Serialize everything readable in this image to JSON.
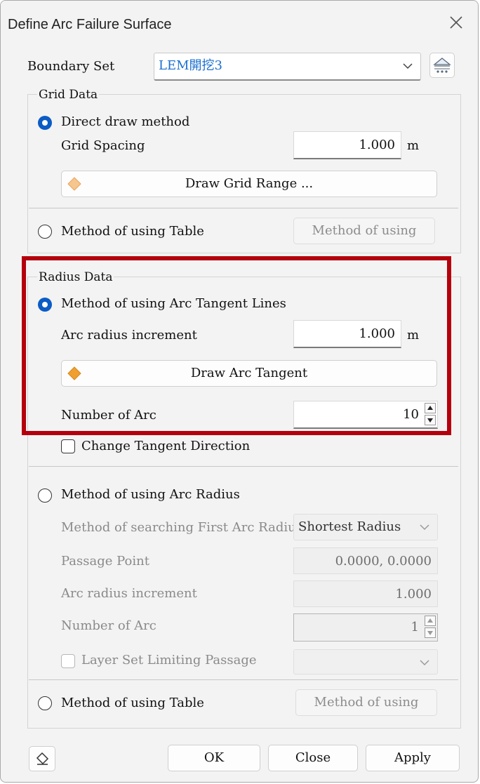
{
  "window": {
    "title": "Define Arc Failure Surface"
  },
  "boundary": {
    "label": "Boundary Set",
    "value": "LEM開挖3",
    "value_color": "#1a6fd1"
  },
  "grid": {
    "group_title": "Grid Data",
    "direct_option": "Direct draw method",
    "spacing_label": "Grid Spacing",
    "spacing_value": "1.000",
    "spacing_unit": "m",
    "draw_button": "Draw Grid Range ...",
    "table_option": "Method of using Table",
    "table_button": "Method of using"
  },
  "radius": {
    "group_title": "Radius Data",
    "tangent_option": "Method of using Arc Tangent Lines",
    "increment_label": "Arc radius increment",
    "increment_value": "1.000",
    "increment_unit": "m",
    "draw_button": "Draw Arc Tangent",
    "number_label": "Number of Arc",
    "number_value": "10",
    "change_direction": "Change Tangent Direction",
    "radius_option": "Method of using Arc Radius",
    "search_label": "Method of searching First Arc Radius",
    "search_value": "Shortest Radius",
    "passage_label": "Passage Point",
    "passage_value": "0.0000, 0.0000",
    "increment2_label": "Arc radius increment",
    "increment2_value": "1.000",
    "number2_label": "Number of Arc",
    "number2_value": "1",
    "layer_label": "Layer Set Limiting Passage",
    "table_option": "Method of using Table",
    "table_button": "Method of using"
  },
  "footer": {
    "ok": "OK",
    "close": "Close",
    "apply": "Apply"
  },
  "colors": {
    "accent": "#0b5cc4",
    "highlight": "#b4000d",
    "diamond": "#f0a030"
  }
}
